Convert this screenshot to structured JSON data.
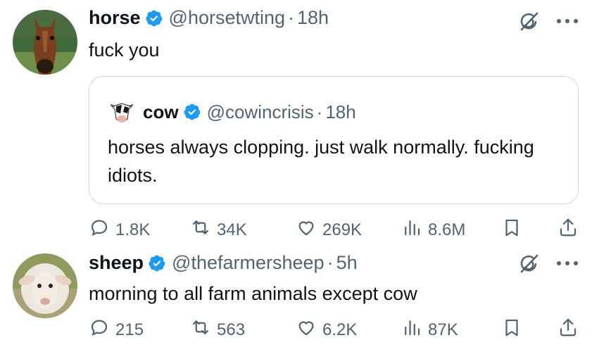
{
  "tweets": [
    {
      "author": {
        "name": "horse",
        "handle": "@horsetwting",
        "time": "18h"
      },
      "text": "fuck you",
      "quote": {
        "author": {
          "name": "cow",
          "handle": "@cowincrisis",
          "time": "18h"
        },
        "text": "horses always clopping. just walk normally. fucking idiots."
      },
      "stats": {
        "replies": "1.8K",
        "reposts": "34K",
        "likes": "269K",
        "views": "8.6M"
      }
    },
    {
      "author": {
        "name": "sheep",
        "handle": "@thefarmersheep",
        "time": "5h"
      },
      "text": "morning to all farm animals except cow",
      "stats": {
        "replies": "215",
        "reposts": "563",
        "likes": "6.2K",
        "views": "87K"
      }
    }
  ],
  "ui": {
    "separator": "·"
  },
  "colors": {
    "verified": "#1d9bf0",
    "secondary_text": "#536471",
    "border": "#cfd9de"
  },
  "icons": [
    "verified-badge-icon",
    "grok-icon",
    "more-icon",
    "reply-icon",
    "repost-icon",
    "like-icon",
    "views-icon",
    "bookmark-icon",
    "share-icon"
  ]
}
